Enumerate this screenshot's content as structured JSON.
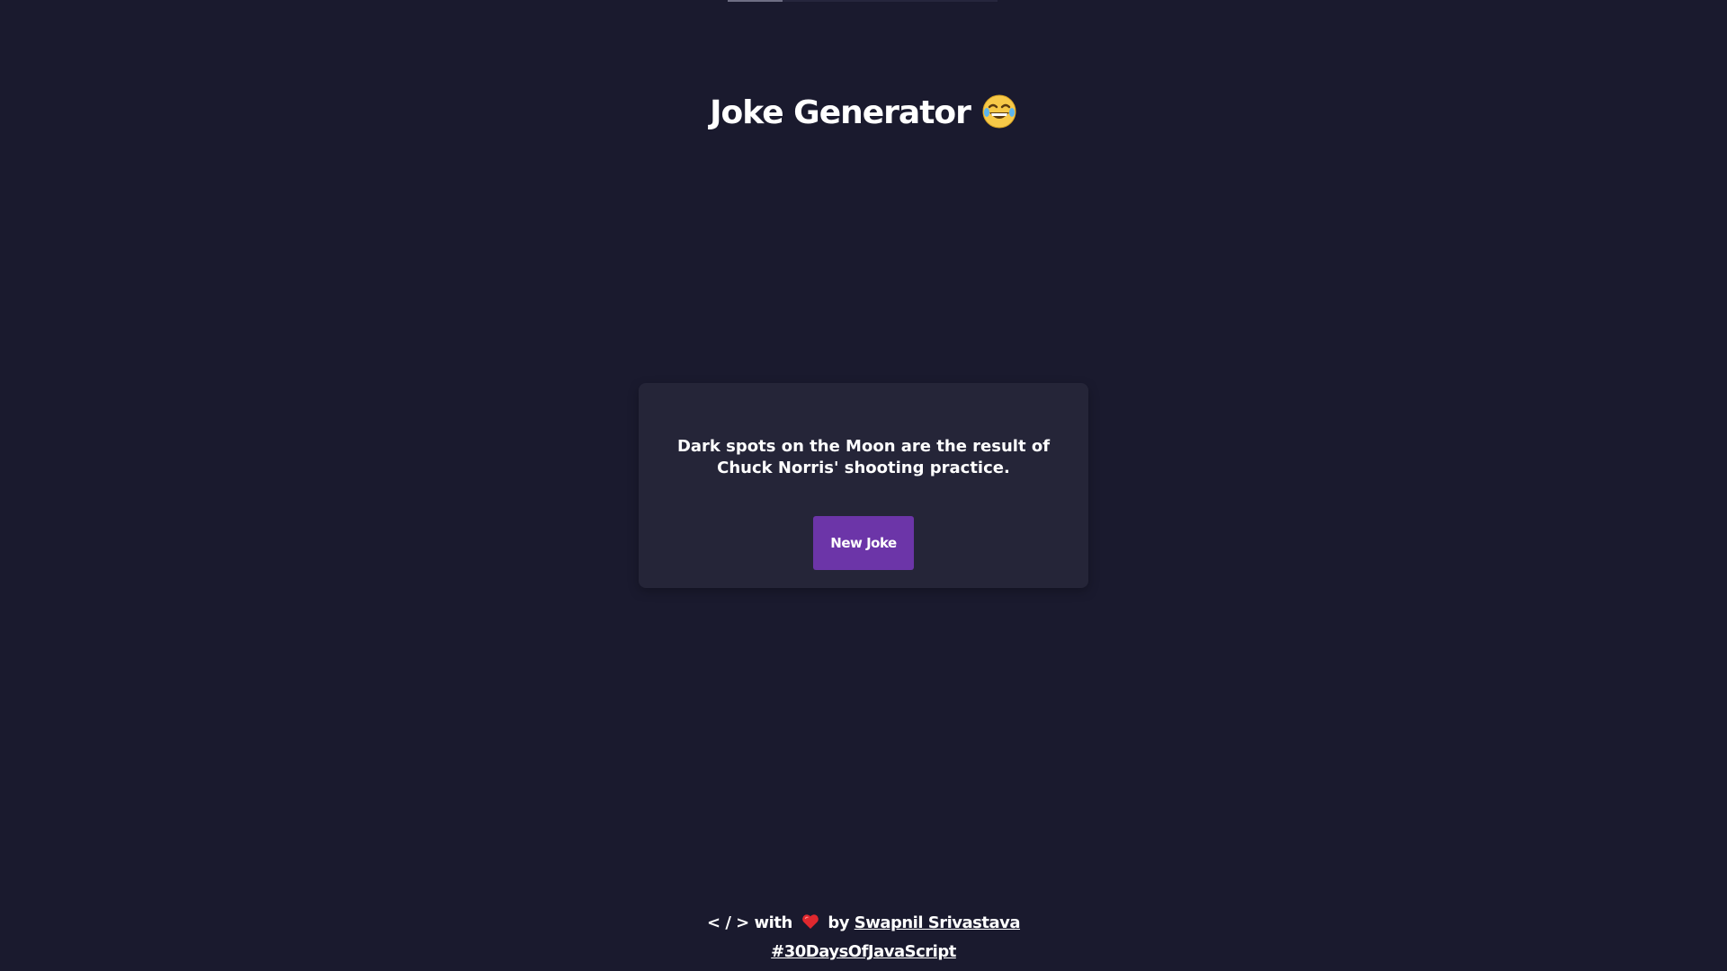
{
  "header": {
    "title": "Joke Generator",
    "title_icon": "laughing-tears-emoji-icon"
  },
  "card": {
    "joke": "Dark spots on the Moon are the result of Chuck Norris' shooting practice.",
    "button_label": "New Joke"
  },
  "footer": {
    "code_symbol": "< / >",
    "with_text": "with",
    "heart_icon": "heart-icon",
    "by_text": "by",
    "author": "Swapnil Srivastava",
    "hashtag": "#30DaysOfJavaScript"
  },
  "colors": {
    "background": "#1a1a2e",
    "card": "#252538",
    "button": "#6c35a8",
    "heart": "#e0282e",
    "text": "#ffffff"
  }
}
